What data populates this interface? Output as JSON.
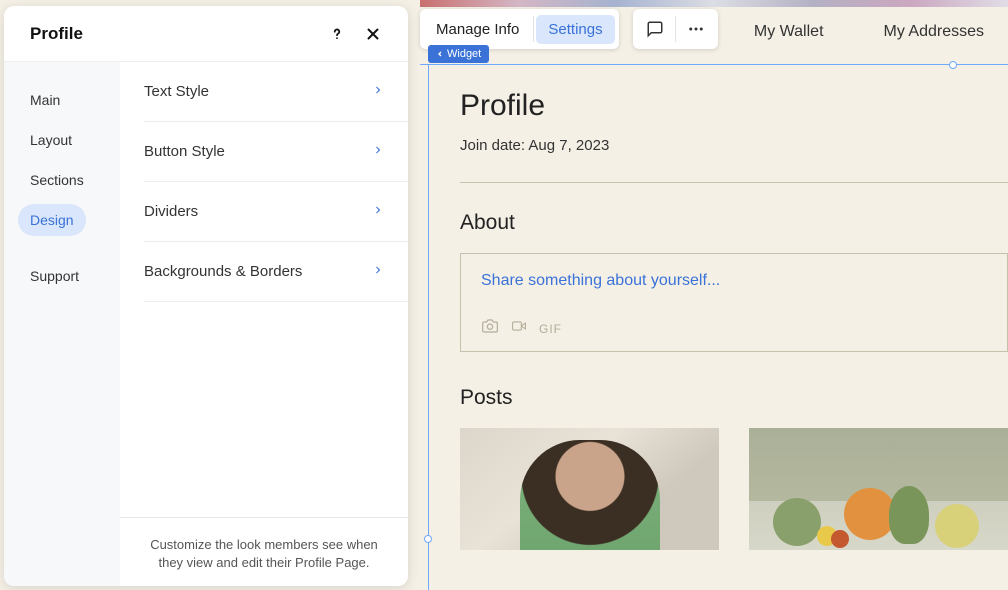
{
  "panel": {
    "title": "Profile",
    "sidebar": [
      {
        "key": "main",
        "label": "Main"
      },
      {
        "key": "layout",
        "label": "Layout"
      },
      {
        "key": "sections",
        "label": "Sections"
      },
      {
        "key": "design",
        "label": "Design",
        "active": true
      },
      {
        "key": "support",
        "label": "Support"
      }
    ],
    "design_items": [
      {
        "key": "text-style",
        "label": "Text Style"
      },
      {
        "key": "button-style",
        "label": "Button Style"
      },
      {
        "key": "dividers",
        "label": "Dividers"
      },
      {
        "key": "backgrounds-borders",
        "label": "Backgrounds & Borders"
      }
    ],
    "footer": "Customize the look members see when they view and edit their Profile Page."
  },
  "toolbar": {
    "manage_info": "Manage Info",
    "settings": "Settings"
  },
  "widget_label": "Widget",
  "tabs": {
    "wallet": "My Wallet",
    "addresses": "My Addresses"
  },
  "profile": {
    "title": "Profile",
    "join_date": "Join date: Aug 7, 2023",
    "about_heading": "About",
    "about_placeholder": "Share something about yourself...",
    "gif_label": "GIF",
    "posts_heading": "Posts"
  }
}
